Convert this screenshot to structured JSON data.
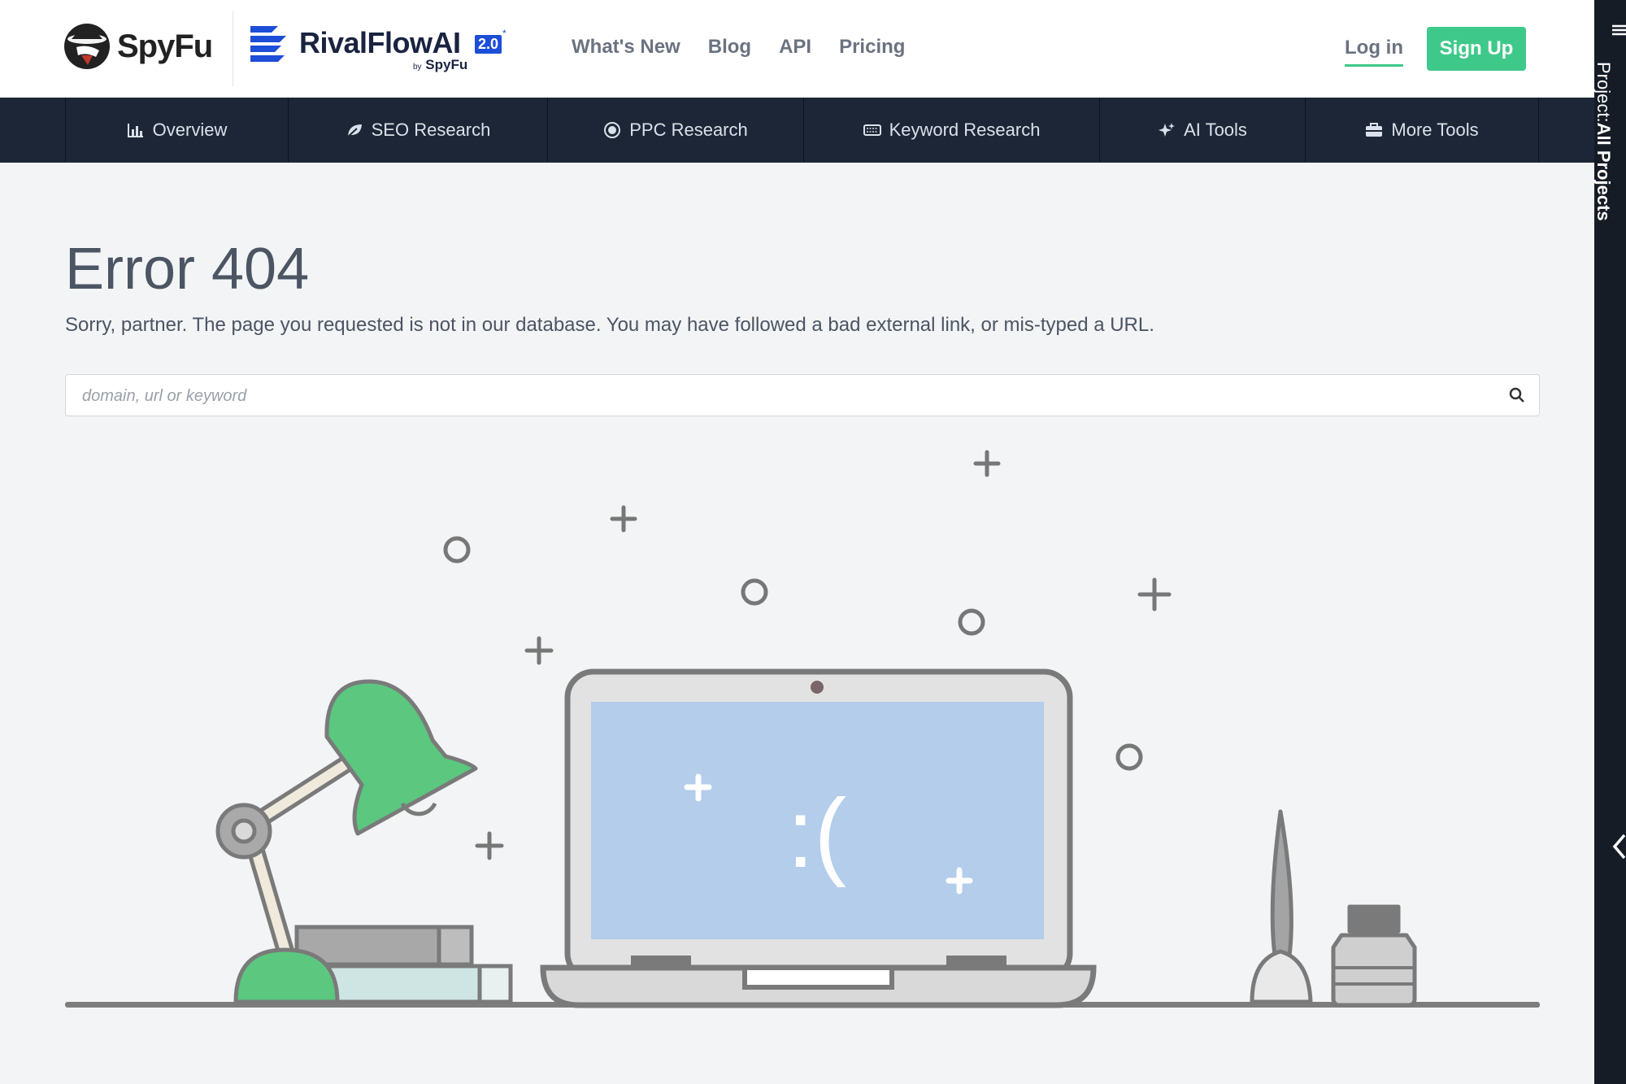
{
  "header": {
    "spyfu_logo_text": "SpyFu",
    "rivalflow": {
      "name": "RivalFlowAI",
      "badge": "2.0",
      "by_prefix": "by",
      "by_brand": "SpyFu"
    },
    "nav": [
      "What's New",
      "Blog",
      "API",
      "Pricing"
    ],
    "login_label": "Log in",
    "signup_label": "Sign Up"
  },
  "main_nav": [
    {
      "label": "Overview",
      "icon": "bar-chart-icon"
    },
    {
      "label": "SEO Research",
      "icon": "leaf-icon"
    },
    {
      "label": "PPC Research",
      "icon": "target-icon"
    },
    {
      "label": "Keyword Research",
      "icon": "keyboard-icon"
    },
    {
      "label": "AI Tools",
      "icon": "sparkle-icon"
    },
    {
      "label": "More Tools",
      "icon": "briefcase-icon"
    }
  ],
  "error": {
    "title": "Error 404",
    "message": "Sorry, partner. The page you requested is not in our database. You may have followed a bad external link, or mis-typed a URL."
  },
  "search": {
    "placeholder": "domain, url or keyword",
    "value": ""
  },
  "illustration": {
    "screen_text": ":("
  },
  "right_panel": {
    "prefix": "Project:",
    "project": "All Projects"
  },
  "colors": {
    "accent": "#3ec98a",
    "nav_bg": "#1c2636",
    "page_bg": "#f3f4f6",
    "brand_blue": "#1d4ed8"
  }
}
